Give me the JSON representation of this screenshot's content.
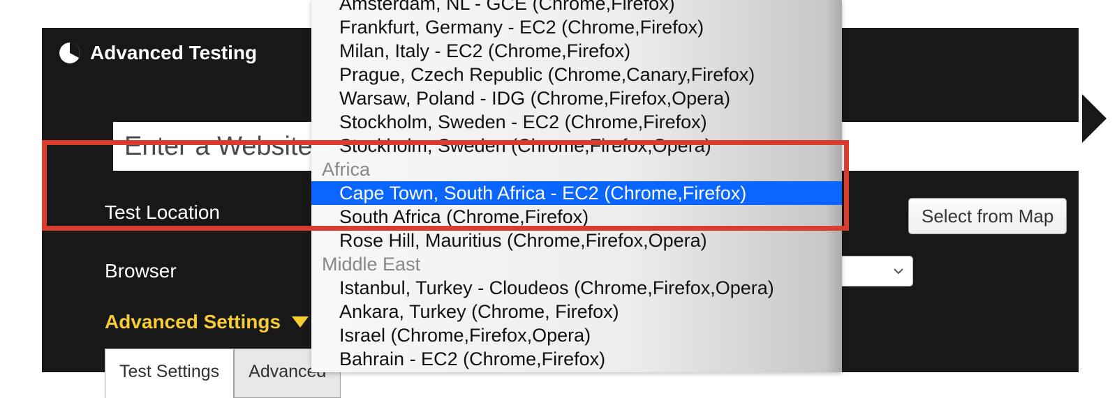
{
  "header": {
    "title": "Advanced Testing"
  },
  "urlInput": {
    "placeholder": "Enter a Website URL"
  },
  "labels": {
    "location": "Test Location",
    "browser": "Browser",
    "advanced": "Advanced Settings"
  },
  "tabs": [
    {
      "id": "settings",
      "label": "Test Settings",
      "active": true
    },
    {
      "id": "advanced",
      "label": "Advanced",
      "active": false
    }
  ],
  "mapButton": {
    "label": "Select from Map"
  },
  "dropdown": {
    "selected": "Cape Town, South Africa - EC2 (Chrome,Firefox)",
    "visible": [
      {
        "kind": "item",
        "label": "Amsterdam, NL - GCE (Chrome,Firefox)",
        "cutTop": true
      },
      {
        "kind": "item",
        "label": "Frankfurt, Germany - EC2 (Chrome,Firefox)"
      },
      {
        "kind": "item",
        "label": "Milan, Italy - EC2 (Chrome,Firefox)"
      },
      {
        "kind": "item",
        "label": "Prague, Czech Republic (Chrome,Canary,Firefox)"
      },
      {
        "kind": "item",
        "label": "Warsaw, Poland - IDG (Chrome,Firefox,Opera)"
      },
      {
        "kind": "item",
        "label": "Stockholm, Sweden - EC2 (Chrome,Firefox)"
      },
      {
        "kind": "item",
        "label": "Stockholm, Sweden (Chrome,Firefox,Opera)"
      },
      {
        "kind": "group",
        "label": "Africa"
      },
      {
        "kind": "item",
        "label": "Cape Town, South Africa - EC2 (Chrome,Firefox)",
        "selected": true
      },
      {
        "kind": "item",
        "label": "South Africa (Chrome,Firefox)"
      },
      {
        "kind": "item",
        "label": "Rose Hill, Mauritius (Chrome,Firefox,Opera)"
      },
      {
        "kind": "group",
        "label": "Middle East"
      },
      {
        "kind": "item",
        "label": "Istanbul, Turkey - Cloudeos (Chrome,Firefox,Opera)"
      },
      {
        "kind": "item",
        "label": "Ankara, Turkey (Chrome, Firefox)"
      },
      {
        "kind": "item",
        "label": "Israel (Chrome,Firefox,Opera)"
      },
      {
        "kind": "item",
        "label": "Bahrain - EC2 (Chrome,Firefox)",
        "cutBottom": true
      }
    ]
  }
}
